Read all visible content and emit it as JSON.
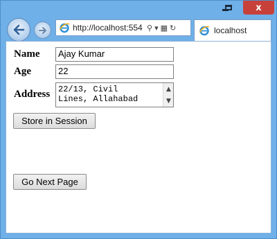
{
  "browser": {
    "address_url": "http://localhost:554",
    "tab_title": "localhost",
    "caption_close": "x"
  },
  "form": {
    "name_label": "Name",
    "name_value": "Ajay Kumar",
    "age_label": "Age",
    "age_value": "22",
    "address_label": "Address",
    "address_value": "22/13, Civil\nLines, Allahabad",
    "store_button": "Store in Session",
    "next_button": "Go Next Page"
  },
  "icons": {
    "back": "back-arrow-icon",
    "forward": "forward-arrow-icon",
    "ie": "ie-logo-icon",
    "search": "search-icon",
    "dropdown": "chevron-down-icon",
    "compat": "compatibility-view-icon",
    "refresh": "refresh-icon"
  },
  "colors": {
    "frame": "#6fb0e8",
    "close": "#c7413a"
  }
}
